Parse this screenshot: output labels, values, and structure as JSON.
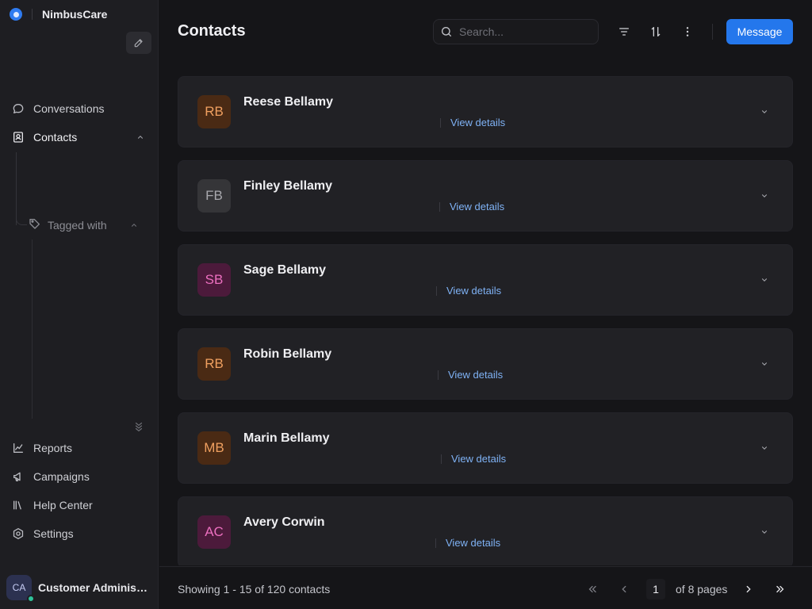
{
  "app": {
    "name": "NimbusCare"
  },
  "sidebar": {
    "items": [
      {
        "label": "Conversations",
        "icon": "chat-bubble-icon"
      },
      {
        "label": "Contacts",
        "icon": "contact-book-icon"
      },
      {
        "label": "Tagged with",
        "icon": "tag-icon"
      },
      {
        "label": "Reports",
        "icon": "chart-icon"
      },
      {
        "label": "Campaigns",
        "icon": "megaphone-icon"
      },
      {
        "label": "Help Center",
        "icon": "library-icon"
      },
      {
        "label": "Settings",
        "icon": "settings-icon"
      }
    ],
    "user": {
      "initials": "CA",
      "name": "Customer Administrator",
      "status_color": "#2fc39a"
    }
  },
  "header": {
    "title": "Contacts",
    "search_placeholder": "Search...",
    "message_label": "Message"
  },
  "contacts": [
    {
      "initials": "RB",
      "name": "Reese Bellamy",
      "link": "View details",
      "bg": "#4a2a14",
      "fg": "#f0a060"
    },
    {
      "initials": "FB",
      "name": "Finley Bellamy",
      "link": "View details",
      "bg": "#353538",
      "fg": "#a8a8ad"
    },
    {
      "initials": "SB",
      "name": "Sage Bellamy",
      "link": "View details",
      "bg": "#4c1a3b",
      "fg": "#ec6fbf"
    },
    {
      "initials": "RB",
      "name": "Robin Bellamy",
      "link": "View details",
      "bg": "#4a2a14",
      "fg": "#f0a060"
    },
    {
      "initials": "MB",
      "name": "Marin Bellamy",
      "link": "View details",
      "bg": "#4a2a14",
      "fg": "#f0a060"
    },
    {
      "initials": "AC",
      "name": "Avery Corwin",
      "link": "View details",
      "bg": "#4c1a3b",
      "fg": "#ec6fbf"
    }
  ],
  "footer": {
    "summary": "Showing 1 - 15 of 120 contacts",
    "page": "1",
    "of_pages": "of 8 pages"
  },
  "colors": {
    "accent": "#2477ec",
    "link": "#7fb2f5",
    "background": "#151518",
    "sidebar": "#1e1e22",
    "card": "#212125"
  }
}
